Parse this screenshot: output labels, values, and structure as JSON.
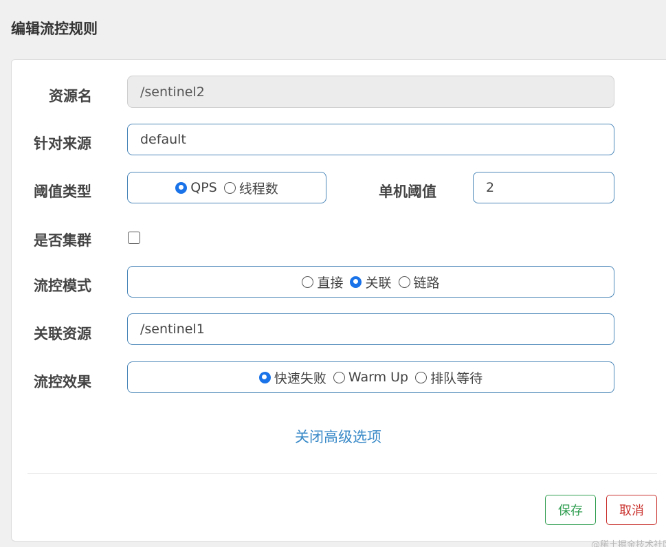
{
  "dialog": {
    "title": "编辑流控规则"
  },
  "form": {
    "resource_name": {
      "label": "资源名",
      "value": "/sentinel2"
    },
    "limit_app": {
      "label": "针对来源",
      "value": "default"
    },
    "grade": {
      "label": "阈值类型",
      "options": [
        {
          "label": "QPS",
          "checked": true
        },
        {
          "label": "线程数",
          "checked": false
        }
      ]
    },
    "threshold": {
      "label": "单机阈值",
      "value": "2"
    },
    "cluster": {
      "label": "是否集群",
      "checked": false
    },
    "strategy": {
      "label": "流控模式",
      "options": [
        {
          "label": "直接",
          "checked": false
        },
        {
          "label": "关联",
          "checked": true
        },
        {
          "label": "链路",
          "checked": false
        }
      ]
    },
    "ref_resource": {
      "label": "关联资源",
      "value": "/sentinel1"
    },
    "control_behavior": {
      "label": "流控效果",
      "options": [
        {
          "label": "快速失败",
          "checked": true
        },
        {
          "label": "Warm Up",
          "checked": false
        },
        {
          "label": "排队等待",
          "checked": false
        }
      ]
    },
    "advanced_toggle": "关闭高级选项"
  },
  "footer": {
    "save_label": "保存",
    "cancel_label": "取消"
  },
  "watermark": "@稀土掘金技术社区"
}
